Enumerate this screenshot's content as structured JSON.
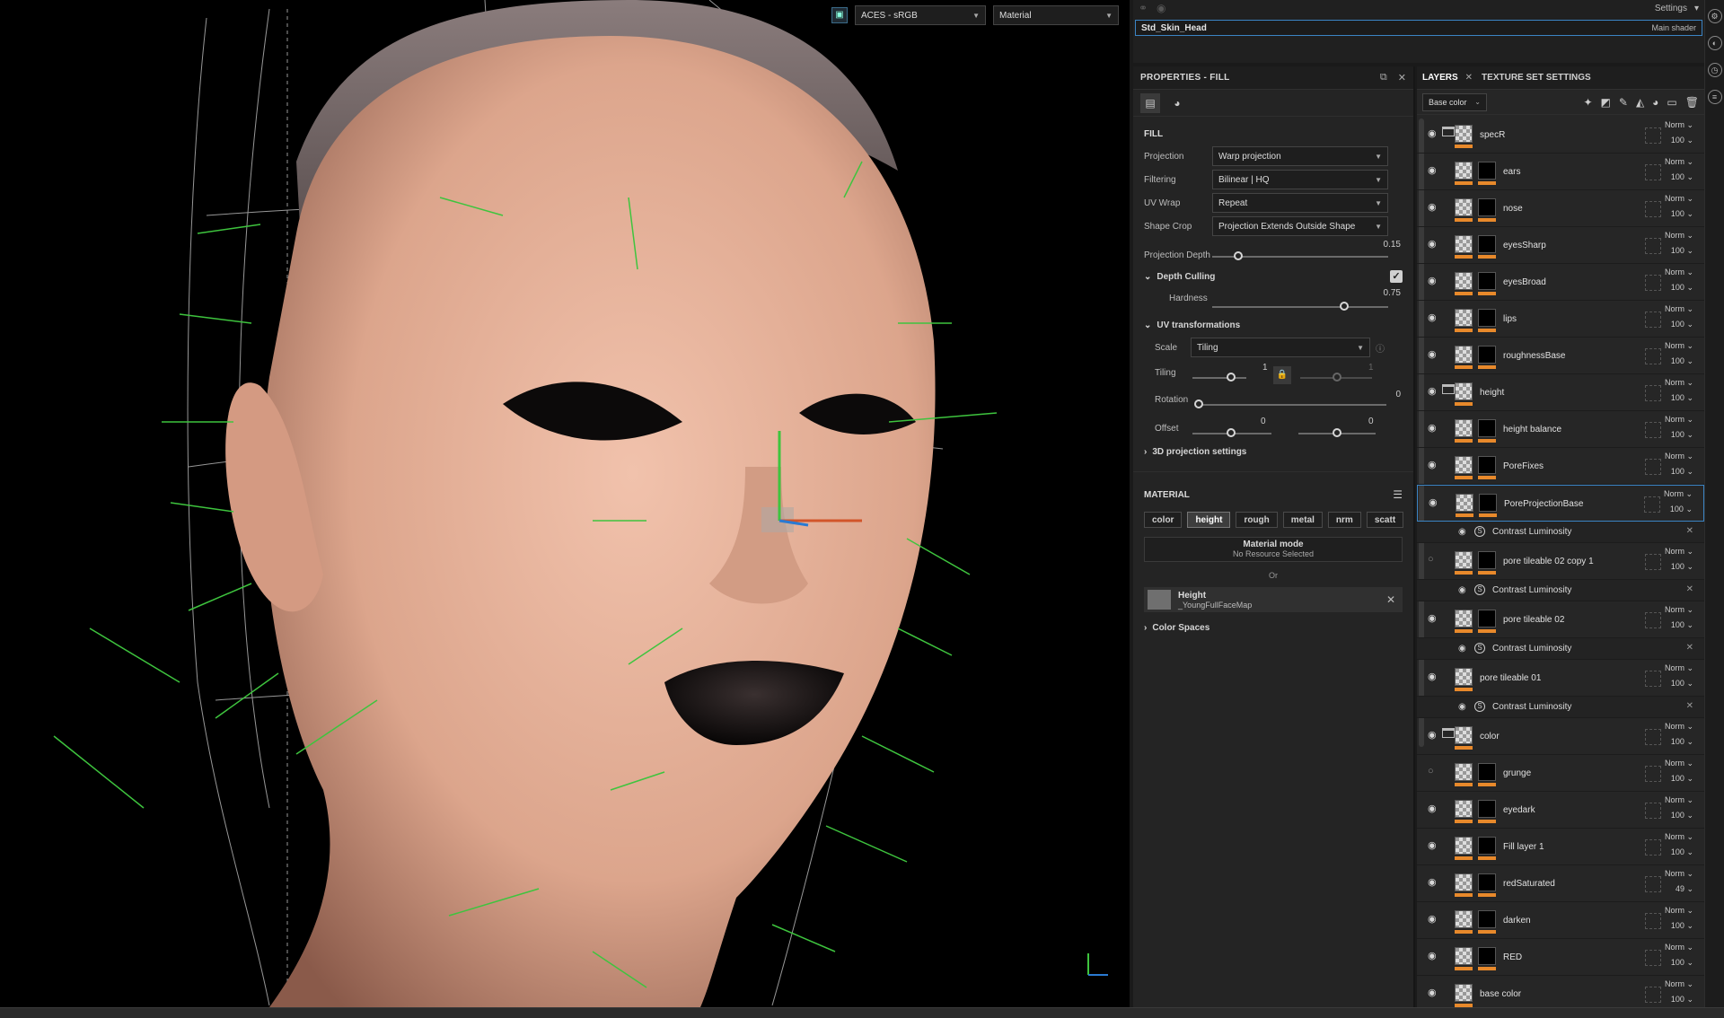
{
  "viewport": {
    "colorspace": "ACES - sRGB",
    "display_mode": "Material"
  },
  "shader": {
    "settings_label": "Settings",
    "name": "Std_Skin_Head",
    "type": "Main shader"
  },
  "properties": {
    "title": "PROPERTIES - FILL",
    "fill_section": "FILL",
    "projection": {
      "label": "Projection",
      "value": "Warp projection"
    },
    "filtering": {
      "label": "Filtering",
      "value": "Bilinear | HQ"
    },
    "uv_wrap": {
      "label": "UV Wrap",
      "value": "Repeat"
    },
    "shape_crop": {
      "label": "Shape Crop",
      "value": "Projection Extends Outside Shape"
    },
    "projection_depth": {
      "label": "Projection Depth",
      "value": "0.15",
      "fraction": 0.15
    },
    "depth_culling": {
      "label": "Depth Culling",
      "checked": true
    },
    "hardness": {
      "label": "Hardness",
      "value": "0.75",
      "fraction": 0.75
    },
    "uv_transformations": "UV transformations",
    "scale": {
      "label": "Scale",
      "value": "Tiling"
    },
    "tiling": {
      "label": "Tiling",
      "value": "1",
      "value2": "1"
    },
    "rotation": {
      "label": "Rotation",
      "value": "0"
    },
    "offset": {
      "label": "Offset",
      "value": "0",
      "value2": "0"
    },
    "projection_3d": "3D projection settings",
    "material_section": "MATERIAL",
    "channels": [
      "color",
      "height",
      "rough",
      "metal",
      "nrm",
      "scatt"
    ],
    "active_channel": "height",
    "material_mode": {
      "title": "Material mode",
      "sub": "No Resource Selected"
    },
    "or_label": "Or",
    "height_resource": {
      "title": "Height",
      "sub": "_YoungFullFaceMap"
    },
    "color_spaces": "Color Spaces"
  },
  "layers_panel": {
    "tab_layers": "LAYERS",
    "tab_texture": "TEXTURE SET SETTINGS",
    "channel_select": "Base color",
    "rows": [
      {
        "kind": "layer",
        "name": "specR",
        "folder": true,
        "blend": "Norm",
        "opacity": "100",
        "visible": true
      },
      {
        "kind": "layer",
        "name": "ears",
        "blend": "Norm",
        "opacity": "100",
        "visible": true
      },
      {
        "kind": "layer",
        "name": "nose",
        "blend": "Norm",
        "opacity": "100",
        "visible": true
      },
      {
        "kind": "layer",
        "name": "eyesSharp",
        "blend": "Norm",
        "opacity": "100",
        "visible": true
      },
      {
        "kind": "layer",
        "name": "eyesBroad",
        "blend": "Norm",
        "opacity": "100",
        "visible": true
      },
      {
        "kind": "layer",
        "name": "lips",
        "blend": "Norm",
        "opacity": "100",
        "visible": true
      },
      {
        "kind": "layer",
        "name": "roughnessBase",
        "blend": "Norm",
        "opacity": "100",
        "visible": true
      },
      {
        "kind": "layer",
        "name": "height",
        "folder": true,
        "blend": "Norm",
        "opacity": "100",
        "visible": true
      },
      {
        "kind": "layer",
        "name": "height balance",
        "blend": "Norm",
        "opacity": "100",
        "visible": true
      },
      {
        "kind": "layer",
        "name": "PoreFixes",
        "blend": "Norm",
        "opacity": "100",
        "visible": true
      },
      {
        "kind": "layer",
        "name": "PoreProjectionBase",
        "blend": "Norm",
        "opacity": "100",
        "visible": true,
        "selected": true
      },
      {
        "kind": "effect",
        "name": "Contrast Luminosity"
      },
      {
        "kind": "layer",
        "name": "pore tileable 02 copy 1",
        "blend": "Norm",
        "opacity": "100",
        "visible": false
      },
      {
        "kind": "effect",
        "name": "Contrast Luminosity"
      },
      {
        "kind": "layer",
        "name": "pore tileable 02",
        "blend": "Norm",
        "opacity": "100",
        "visible": true
      },
      {
        "kind": "effect",
        "name": "Contrast Luminosity"
      },
      {
        "kind": "layer",
        "name": "pore tileable 01",
        "blend": "Norm",
        "opacity": "100",
        "visible": true,
        "nomask": true
      },
      {
        "kind": "effect",
        "name": "Contrast Luminosity"
      },
      {
        "kind": "layer",
        "name": "color",
        "folder": true,
        "blend": "Norm",
        "opacity": "100",
        "visible": true
      },
      {
        "kind": "layer",
        "name": "grunge",
        "blend": "Norm",
        "opacity": "100",
        "visible": false
      },
      {
        "kind": "layer",
        "name": "eyedark",
        "blend": "Norm",
        "opacity": "100",
        "visible": true
      },
      {
        "kind": "layer",
        "name": "Fill layer 1",
        "blend": "Norm",
        "opacity": "100",
        "visible": true
      },
      {
        "kind": "layer",
        "name": "redSaturated",
        "blend": "Norm",
        "opacity": "49",
        "visible": true
      },
      {
        "kind": "layer",
        "name": "darken",
        "blend": "Norm",
        "opacity": "100",
        "visible": true
      },
      {
        "kind": "layer",
        "name": "RED",
        "blend": "Norm",
        "opacity": "100",
        "visible": true
      },
      {
        "kind": "layer",
        "name": "base color",
        "blend": "Norm",
        "opacity": "100",
        "visible": true,
        "nomask": true
      }
    ]
  },
  "colors": {
    "accent": "#3b84c4",
    "channel_bar": "#e8892b",
    "skin": "#e8b098"
  }
}
